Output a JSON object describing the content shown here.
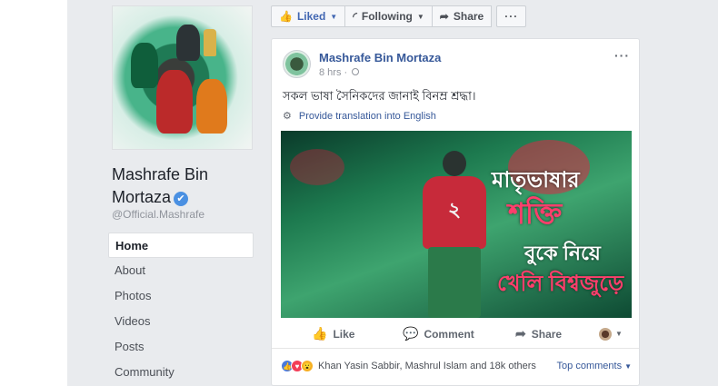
{
  "profile": {
    "name": "Mashrafe Bin Mortaza",
    "handle": "@Official.Mashrafe",
    "verified_glyph": "✔"
  },
  "nav": {
    "items": [
      {
        "label": "Home"
      },
      {
        "label": "About"
      },
      {
        "label": "Photos"
      },
      {
        "label": "Videos"
      },
      {
        "label": "Posts"
      },
      {
        "label": "Community"
      }
    ]
  },
  "actions": {
    "liked": "Liked",
    "following": "Following",
    "share": "Share",
    "more": "···"
  },
  "post": {
    "author": "Mashrafe Bin Mortaza",
    "time": "8 hrs",
    "text": "সকল ভাষা সৈনিকদের জানাই বিনম্র শ্রদ্ধা।",
    "translate": "Provide translation into English",
    "more": "···",
    "image": {
      "line1": "মাতৃভাষার",
      "line2": "শক্তি",
      "line3": "বুকে নিয়ে",
      "line4": "খেলি বিশ্বজুড়ে",
      "jersey_number": "২"
    },
    "buttons": {
      "like": "Like",
      "comment": "Comment",
      "share": "Share"
    },
    "reactions_summary": "Khan Yasin Sabbir, Mashrul Islam and 18k others",
    "top_comments": "Top comments"
  },
  "icons": {
    "like": "thumbs-up-icon",
    "following": "rss-icon",
    "share": "share-arrow-icon",
    "comment": "speech-bubble-icon",
    "globe": "globe-icon",
    "gear": "gear-icon"
  },
  "colors": {
    "link": "#365899",
    "accent": "#4267b2",
    "background": "#e9ebee"
  }
}
